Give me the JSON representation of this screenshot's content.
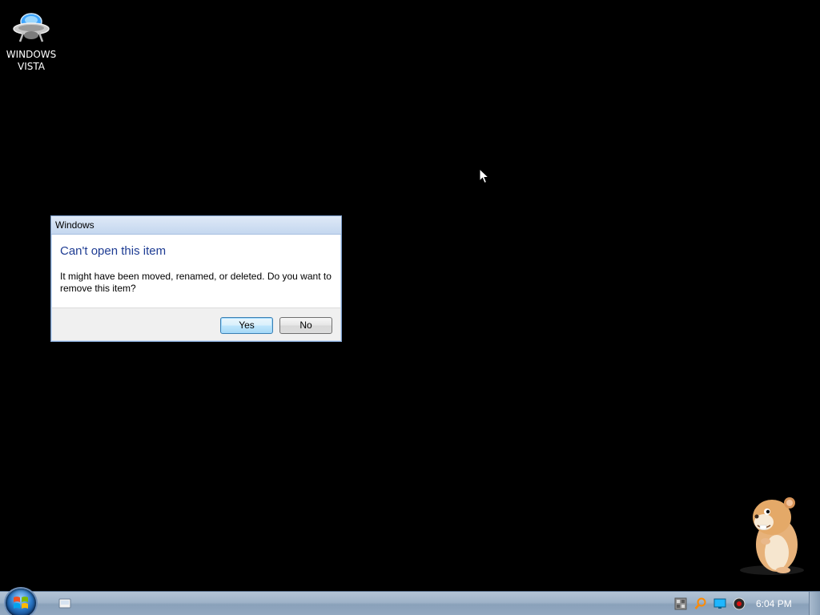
{
  "desktop": {
    "icons": [
      {
        "label": "WINDOWS\nVISTA",
        "icon": "vista-ufo-icon"
      }
    ]
  },
  "dialog": {
    "title": "Windows",
    "heading": "Can't open this item",
    "message": "It might have been moved, renamed, or deleted. Do you want to remove this item?",
    "buttons": {
      "yes": "Yes",
      "no": "No"
    }
  },
  "taskbar": {
    "start_icon": "windows-logo-icon",
    "quicklaunch": [
      {
        "icon": "show-desktop-icon"
      }
    ],
    "tray": [
      {
        "icon": "network-icon"
      },
      {
        "icon": "search-icon"
      },
      {
        "icon": "monitor-icon"
      },
      {
        "icon": "speaker-icon"
      }
    ],
    "clock": "6:04 PM"
  },
  "colors": {
    "desktop_bg": "#000000",
    "dialog_heading": "#1e3c93",
    "taskbar": "#9fb3c9"
  }
}
